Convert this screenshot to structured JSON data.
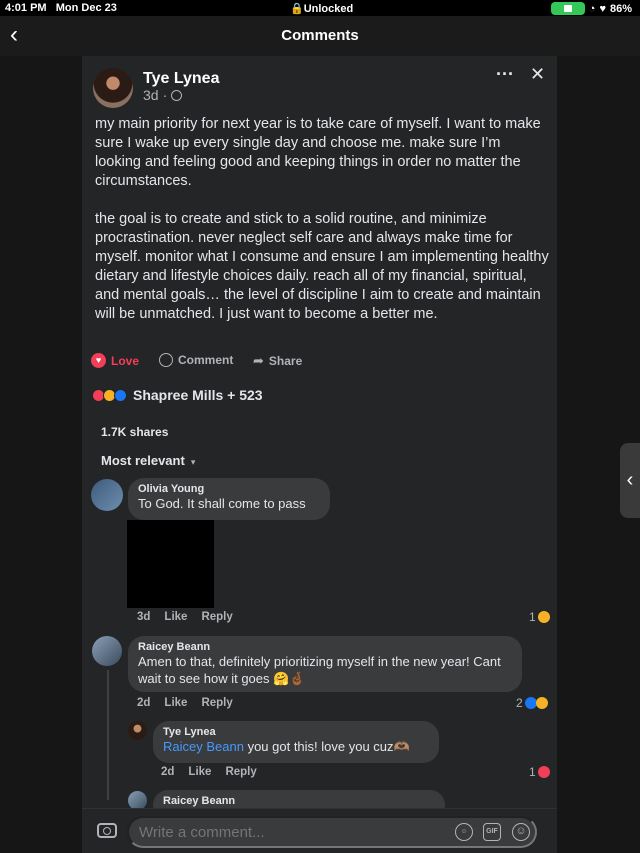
{
  "status_bar": {
    "time": "4:01 PM",
    "date": "Mon Dec 23",
    "lock": "Unlocked",
    "battery": "86%",
    "battery_icon": "battery-icon",
    "wifi_icon": "wifi-icon"
  },
  "header": {
    "title": "Comments",
    "back_icon": "chevron-left-icon"
  },
  "post": {
    "author": "Tye Lynea",
    "time": "3d",
    "paragraph1": "my main priority for next year is to take care of myself. I want to make sure I wake up every single day and choose me. make sure I’m looking and feeling good and keeping things in order no matter the circumstances.",
    "paragraph2": "the goal is to create and stick to a solid routine, and minimize procrastination. never neglect self care and always make time for myself. monitor what I consume and ensure I am implementing healthy dietary and lifestyle choices daily. reach all of my financial, spiritual, and mental goals… the level of discipline I aim to create and maintain will be unmatched. I just want to become a better me.",
    "love_label": "Love",
    "comment_label": "Comment",
    "share_label": "Share",
    "reactions_text": "Shapree Mills + 523",
    "shares_text": "1.7K shares",
    "sort_label": "Most relevant",
    "colors": {
      "love": "#f33e58",
      "mention": "#4599ff",
      "like": "#1877f2"
    }
  },
  "comments": [
    {
      "name": "Olivia Young",
      "text": "To God. It shall come to pass",
      "time": "3d",
      "like": "Like",
      "reply": "Reply",
      "reaction_count": "1"
    },
    {
      "name": "Raicey Beann",
      "text": "Amen to that, definitely prioritizing myself in the new year! Cant wait to see how it goes 🤗🤞🏾",
      "time": "2d",
      "like": "Like",
      "reply": "Reply",
      "reaction_count": "2"
    },
    {
      "name": "Tye Lynea",
      "mention": "Raicey Beann",
      "text": " you got this! love you cuz🫶🏽",
      "time": "2d",
      "like": "Like",
      "reply": "Reply",
      "reaction_count": "1"
    },
    {
      "name": "Raicey Beann"
    }
  ],
  "composer": {
    "placeholder": "Write a comment..."
  }
}
